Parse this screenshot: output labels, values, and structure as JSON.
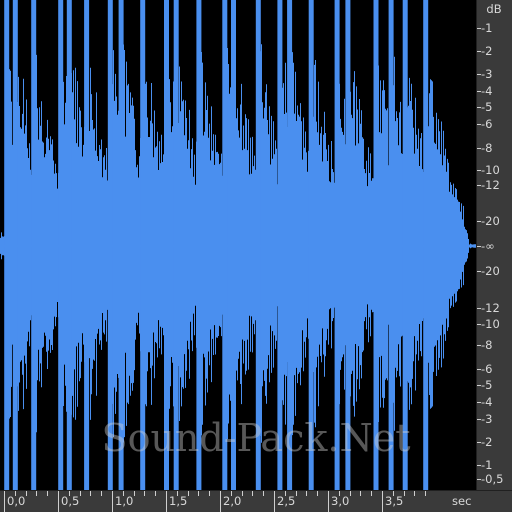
{
  "db_scale": {
    "unit": "dB",
    "labels": [
      "-1",
      "-2",
      "-3",
      "-4",
      "-5",
      "-6",
      "-8",
      "-10",
      "-12",
      "-20",
      "-∞",
      "-20",
      "-12",
      "-10",
      "-8",
      "-6",
      "-5",
      "-4",
      "-3",
      "-2",
      "-1",
      "-0,5"
    ]
  },
  "time_ruler": {
    "unit": "sec",
    "labels": [
      "0,0",
      "0,5",
      "1,0",
      "1,5",
      "2,0",
      "2,5",
      "3,0",
      "3,5"
    ]
  },
  "waveform": {
    "color": "#4a8fef",
    "background": "#000000",
    "hit_times_sec": [
      0.02,
      0.1,
      0.27,
      0.52,
      0.6,
      0.76,
      0.98,
      1.08,
      1.28,
      1.5,
      1.59,
      1.8,
      2.04,
      2.12,
      2.35,
      2.55,
      2.64,
      2.84,
      3.08,
      3.18,
      3.44,
      3.58,
      3.71,
      3.9
    ],
    "decay_end_sec": 4.3
  },
  "watermark": "Sound-Pack.Net",
  "colors": {
    "ruler_bg": "#3a3a3a",
    "ruler_text": "#d8d8d8",
    "waveform": "#4a8fef"
  }
}
